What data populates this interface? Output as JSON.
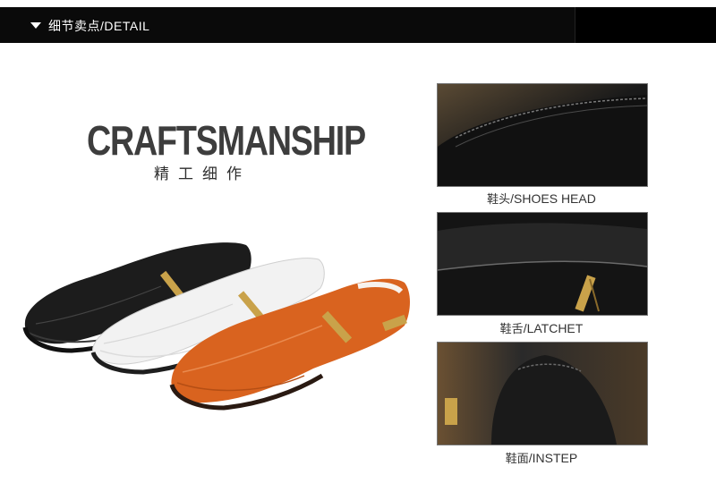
{
  "section_header": {
    "label_cn": "细节卖点",
    "label_en": "/DETAIL"
  },
  "hero": {
    "title": "CRAFTSMANSHIP",
    "subtitle": "精工细作"
  },
  "products": [
    {
      "color_name": "black",
      "color": "#1c1c1c"
    },
    {
      "color_name": "white",
      "color": "#f2f2f2"
    },
    {
      "color_name": "orange",
      "color": "#d9631f"
    }
  ],
  "details": [
    {
      "caption_cn": "鞋头",
      "caption_en": "/SHOES HEAD"
    },
    {
      "caption_cn": "鞋舌",
      "caption_en": "/LATCHET"
    },
    {
      "caption_cn": "鞋面",
      "caption_en": "/INSTEP"
    }
  ],
  "colors": {
    "header_bg": "#0a0a0a",
    "header_text": "#ffffff",
    "title_text": "#3d3d3d",
    "caption_text": "#333333",
    "zipper_gold": "#c9a24a"
  }
}
